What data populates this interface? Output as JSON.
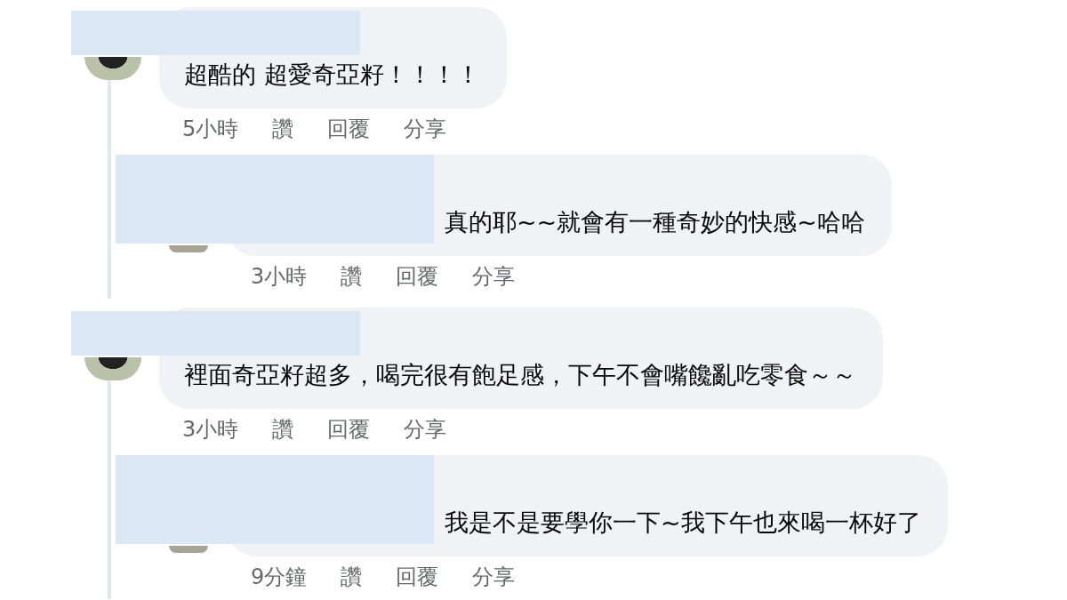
{
  "threads": [
    {
      "text": "超酷的 超愛奇亞籽！！！！",
      "actions": [
        "5小時",
        "讚",
        "回覆",
        "分享"
      ],
      "replies": [
        {
          "text": "真的耶~~就會有一種奇妙的快感~哈哈",
          "actions": [
            "3小時",
            "讚",
            "回覆",
            "分享"
          ]
        }
      ]
    },
    {
      "text": "裡面奇亞籽超多，喝完很有飽足感，下午不會嘴饞亂吃零食～～",
      "actions": [
        "3小時",
        "讚",
        "回覆",
        "分享"
      ],
      "replies": [
        {
          "text": "我是不是要學你一下~我下午也來喝一杯好了",
          "actions": [
            "9分鐘",
            "讚",
            "回覆",
            "分享"
          ]
        }
      ]
    }
  ]
}
